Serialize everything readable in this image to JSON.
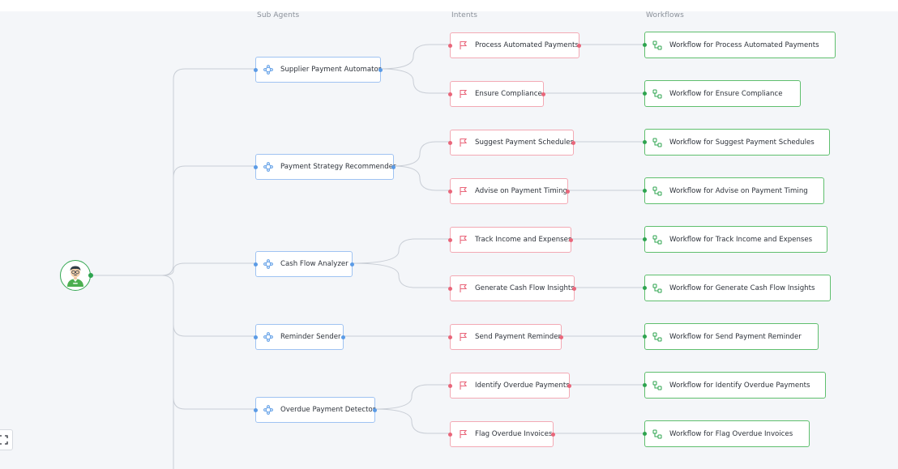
{
  "columns": {
    "sub_agents": "Sub Agents",
    "intents": "Intents",
    "workflows": "Workflows"
  },
  "icons": {
    "root": "user-avatar-icon",
    "agent": "agent-network-icon",
    "intent": "flag-icon",
    "workflow": "workflow-icon",
    "fit": "fit-view-icon"
  },
  "colors": {
    "agent": "#5b9be6",
    "intent": "#e9667a",
    "workflow": "#2ea44f",
    "link": "#c9ced6"
  },
  "agents": [
    {
      "label": "Supplier Payment Automator"
    },
    {
      "label": "Payment Strategy Recommender"
    },
    {
      "label": "Cash Flow Analyzer"
    },
    {
      "label": "Reminder Sender"
    },
    {
      "label": "Overdue Payment Detector"
    }
  ],
  "intents": [
    {
      "label": "Process Automated Payments"
    },
    {
      "label": "Ensure Compliance"
    },
    {
      "label": "Suggest Payment Schedules"
    },
    {
      "label": "Advise on Payment Timing"
    },
    {
      "label": "Track Income and Expenses"
    },
    {
      "label": "Generate Cash Flow Insights"
    },
    {
      "label": "Send Payment Reminder"
    },
    {
      "label": "Identify Overdue Payments"
    },
    {
      "label": "Flag Overdue Invoices"
    }
  ],
  "workflows": [
    {
      "label": "Workflow for Process Automated Payments"
    },
    {
      "label": "Workflow for Ensure Compliance"
    },
    {
      "label": "Workflow for Suggest Payment Schedules"
    },
    {
      "label": "Workflow for Advise on Payment Timing"
    },
    {
      "label": "Workflow for Track Income and Expenses"
    },
    {
      "label": "Workflow for Generate Cash Flow Insights"
    },
    {
      "label": "Workflow for Send Payment Reminder"
    },
    {
      "label": "Workflow for Identify Overdue Payments"
    },
    {
      "label": "Workflow for Flag Overdue Invoices"
    }
  ]
}
